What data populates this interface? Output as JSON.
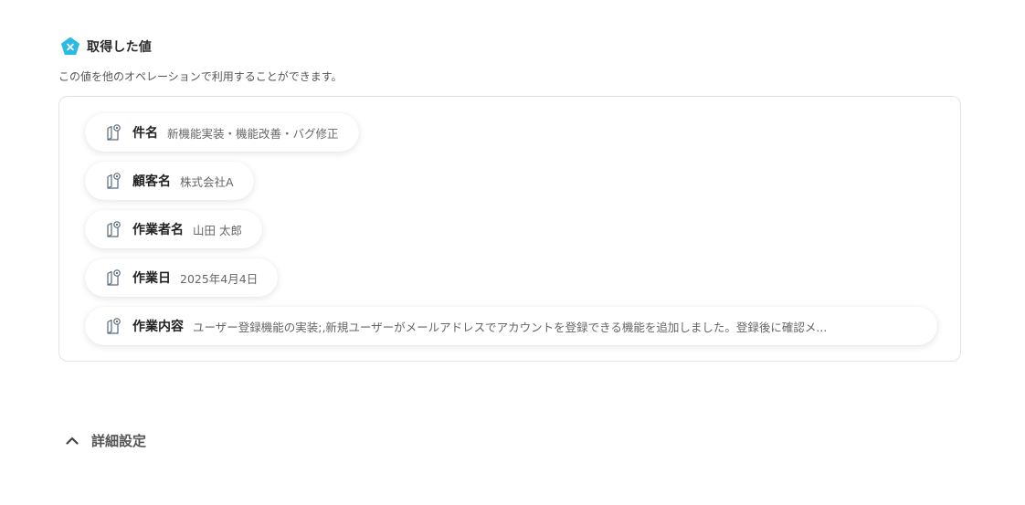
{
  "header": {
    "title": "取得した値",
    "icon": "x-badge-icon",
    "accent": "#2bb9e6"
  },
  "description": "この値を他のオペレーションで利用することができます。",
  "fields": [
    {
      "key": "件名",
      "value": "新機能実装・機能改善・バグ修正",
      "icon": "document-link-icon"
    },
    {
      "key": "顧客名",
      "value": "株式会社A",
      "icon": "document-link-icon"
    },
    {
      "key": "作業者名",
      "value": "山田 太郎",
      "icon": "document-link-icon"
    },
    {
      "key": "作業日",
      "value": "2025年4月4日",
      "icon": "document-link-icon"
    },
    {
      "key": "作業内容",
      "value": "ユーザー登録機能の実装;,新規ユーザーがメールアドレスでアカウントを登録できる機能を追加しました。登録後に確認メ...",
      "icon": "document-link-icon"
    }
  ],
  "advanced": {
    "label": "詳細設定",
    "icon": "chevron-up-icon"
  }
}
